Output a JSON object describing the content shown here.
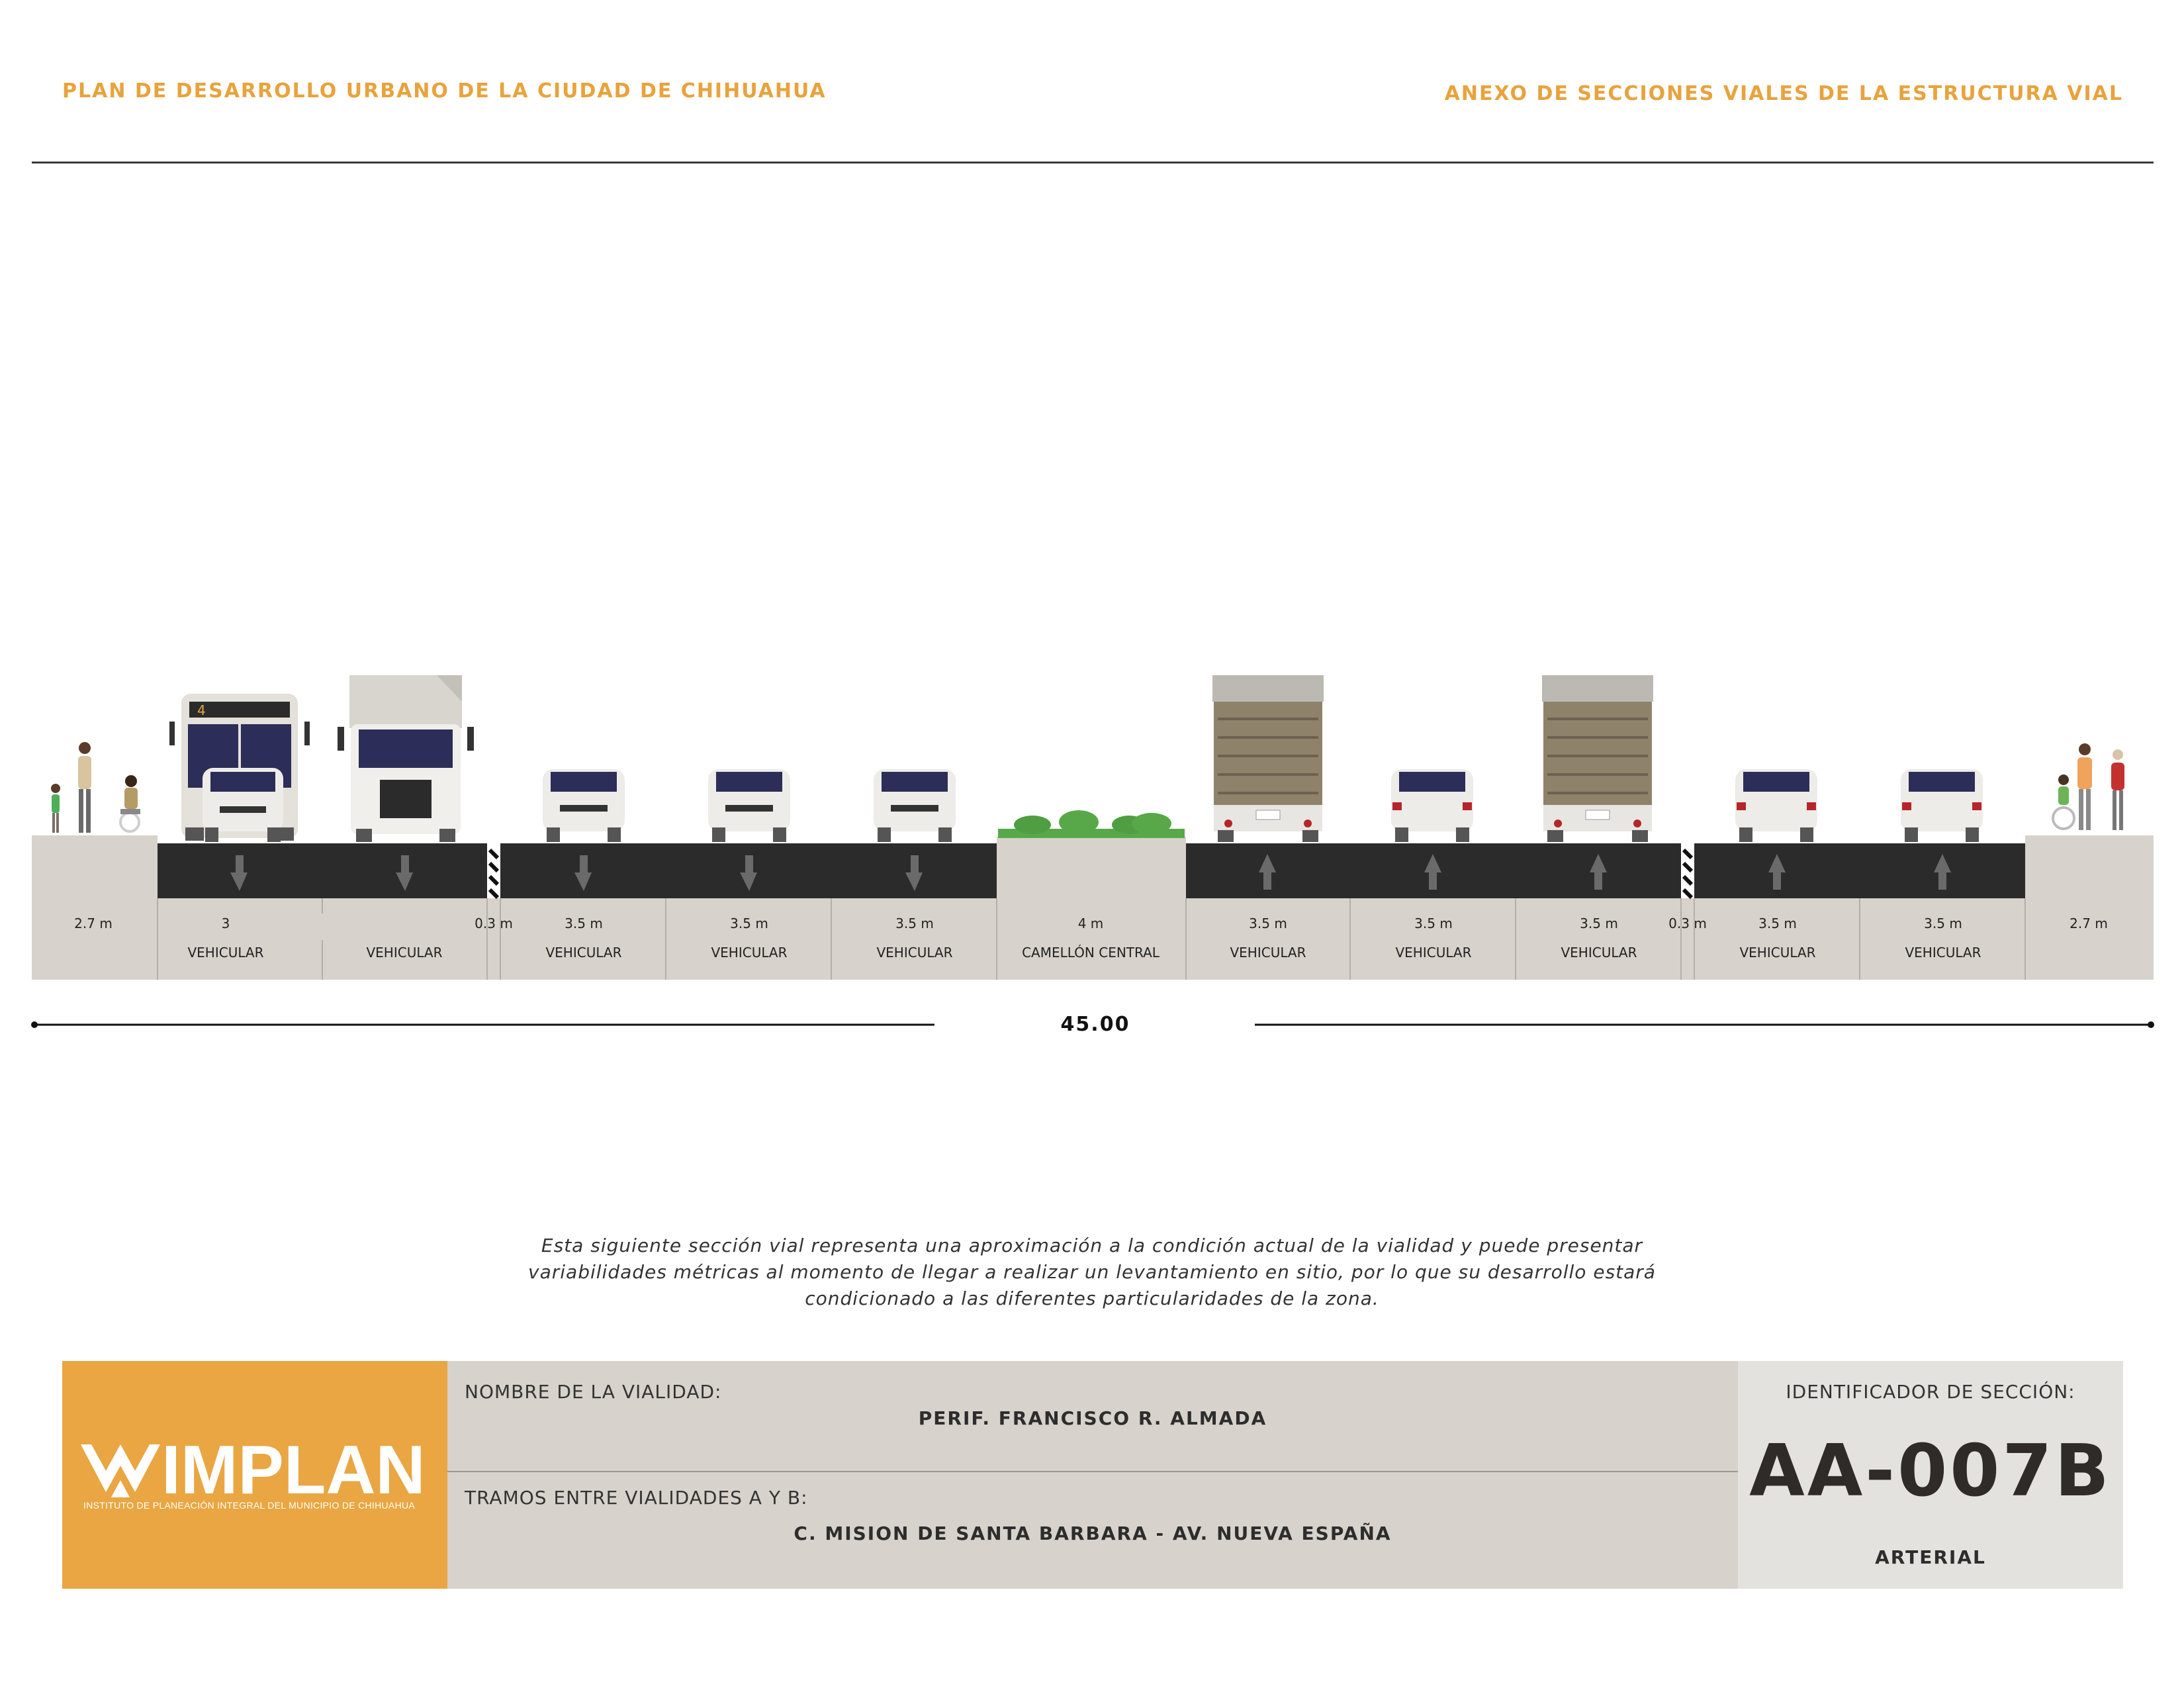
{
  "header": {
    "left_title": "PLAN DE DESARROLLO URBANO DE LA CIUDAD DE CHIHUAHUA",
    "right_title": "ANEXO DE SECCIONES VIALES DE LA ESTRUCTURA VIAL"
  },
  "section": {
    "total_width": "45.00",
    "segments": [
      {
        "width": "2.7 m",
        "use": ""
      },
      {
        "width": "3",
        "use": "VEHICULAR"
      },
      {
        "width": "",
        "use": "VEHICULAR"
      },
      {
        "width": "0.3 m",
        "use": ""
      },
      {
        "width": "3.5 m",
        "use": "VEHICULAR"
      },
      {
        "width": "3.5 m",
        "use": "VEHICULAR"
      },
      {
        "width": "3.5 m",
        "use": "VEHICULAR"
      },
      {
        "width": "4 m",
        "use": "CAMELLÓN CENTRAL"
      },
      {
        "width": "3.5 m",
        "use": "VEHICULAR"
      },
      {
        "width": "3.5 m",
        "use": "VEHICULAR"
      },
      {
        "width": "3.5 m",
        "use": "VEHICULAR"
      },
      {
        "width": "0.3 m",
        "use": ""
      },
      {
        "width": "3.5 m",
        "use": "VEHICULAR"
      },
      {
        "width": "3.5 m",
        "use": "VEHICULAR"
      },
      {
        "width": "2.7 m",
        "use": ""
      }
    ],
    "bus_route_number": "4"
  },
  "note": {
    "line1": "Esta siguiente sección vial representa una aproximación a la condición actual de la vialidad y puede presentar",
    "line2": "variabilidades métricas al momento de llegar a realizar un levantamiento en sitio, por lo que su desarrollo estará",
    "line3": "condicionado a las diferentes particularidades de la zona."
  },
  "footer": {
    "logo_name": "IMPLAN",
    "logo_subtitle": "INSTITUTO DE PLANEACIÓN INTEGRAL DEL MUNICIPIO DE CHIHUAHUA",
    "name_label": "NOMBRE DE LA VIALIDAD:",
    "name_value": "PERIF. FRANCISCO R. ALMADA",
    "tramos_label": "TRAMOS ENTRE VIALIDADES A Y B:",
    "tramos_value": "C. MISION DE SANTA BARBARA - AV. NUEVA ESPAÑA",
    "id_label": "IDENTIFICADOR DE SECCIÓN:",
    "id_value": "AA-007B",
    "classification": "ARTERIAL"
  },
  "colors": {
    "accent": "#e9a642",
    "asphalt": "#2b2b2b",
    "sidewalk": "#d7d2cb",
    "vegetation": "#58a84a"
  }
}
